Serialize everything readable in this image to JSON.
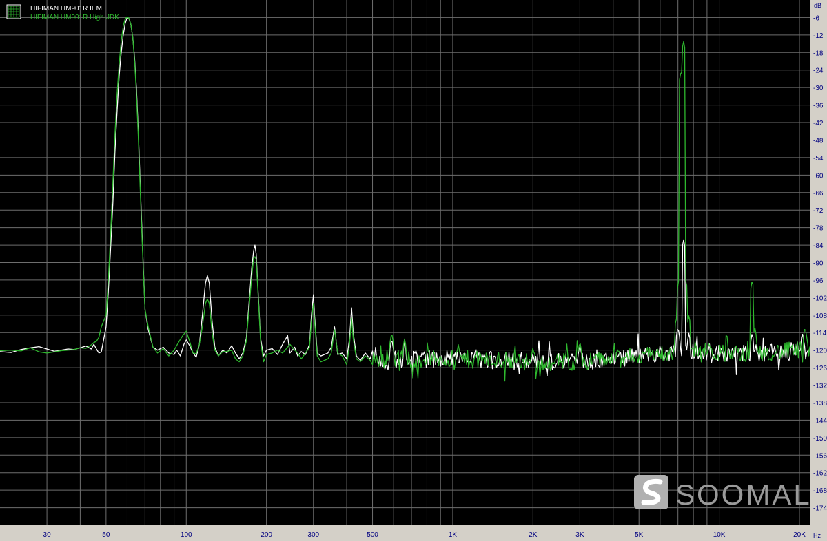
{
  "colors": {
    "background": "#000000",
    "grid": "#6e6e6e",
    "axis_panel": "#d4d0c8",
    "tick_label": "#000080",
    "series_white": "#ffffff",
    "series_green": "#2eb82e",
    "watermark": "#9a9a9a"
  },
  "legend": {
    "icon": "grid-icon",
    "entries": [
      {
        "label": "HIFIMAN HM901R IEM",
        "color": "#ffffff"
      },
      {
        "label": "HIFIMAN HM901R High-JDK",
        "color": "#2eb82e"
      }
    ]
  },
  "watermark": {
    "text": "SOOMAL",
    "icon": "soomal-logo-icon"
  },
  "chart_data": {
    "type": "line",
    "title": "",
    "xlabel": "",
    "ylabel": "",
    "x_unit": "Hz",
    "y_unit": "dB",
    "x_scale": "log",
    "xlim": [
      20,
      22000
    ],
    "ylim": [
      -180,
      0
    ],
    "grid": true,
    "legend_position": "top-left",
    "x_ticks": [
      {
        "value": 30,
        "label": "30"
      },
      {
        "value": 50,
        "label": "50"
      },
      {
        "value": 100,
        "label": "100"
      },
      {
        "value": 200,
        "label": "200"
      },
      {
        "value": 300,
        "label": "300"
      },
      {
        "value": 500,
        "label": "500"
      },
      {
        "value": 1000,
        "label": "1K"
      },
      {
        "value": 2000,
        "label": "2K"
      },
      {
        "value": 3000,
        "label": "3K"
      },
      {
        "value": 5000,
        "label": "5K"
      },
      {
        "value": 10000,
        "label": "10K"
      },
      {
        "value": 20000,
        "label": "20K"
      }
    ],
    "y_ticks": [
      -6,
      -12,
      -18,
      -24,
      -30,
      -36,
      -42,
      -48,
      -54,
      -60,
      -66,
      -72,
      -78,
      -84,
      -90,
      -96,
      -102,
      -108,
      -114,
      -120,
      -126,
      -132,
      -138,
      -144,
      -150,
      -156,
      -162,
      -168,
      -174
    ],
    "series": [
      {
        "name": "HIFIMAN HM901R IEM",
        "color": "#ffffff",
        "points": [
          [
            20,
            -120.5
          ],
          [
            22,
            -120.8
          ],
          [
            24,
            -119.8
          ],
          [
            26,
            -119.2
          ],
          [
            28,
            -118.8
          ],
          [
            30,
            -119.6
          ],
          [
            32,
            -120.4
          ],
          [
            34,
            -120.0
          ],
          [
            36,
            -119.6
          ],
          [
            38,
            -119.8
          ],
          [
            40,
            -119.2
          ],
          [
            42,
            -118.6
          ],
          [
            44,
            -119.6
          ],
          [
            45,
            -118.0
          ],
          [
            46,
            -119.6
          ],
          [
            47,
            -121.0
          ],
          [
            48,
            -120.6
          ],
          [
            50,
            -112.0
          ],
          [
            51,
            -100.0
          ],
          [
            52,
            -85.0
          ],
          [
            53,
            -70.0
          ],
          [
            54,
            -52.0
          ],
          [
            55,
            -38.0
          ],
          [
            56,
            -26.0
          ],
          [
            57,
            -18.0
          ],
          [
            58,
            -12.0
          ],
          [
            59,
            -8.0
          ],
          [
            60,
            -6.0
          ],
          [
            61,
            -6.5
          ],
          [
            62,
            -8.5
          ],
          [
            63,
            -13.0
          ],
          [
            64,
            -20.0
          ],
          [
            65,
            -30.0
          ],
          [
            66,
            -44.0
          ],
          [
            67,
            -60.0
          ],
          [
            68,
            -76.0
          ],
          [
            69,
            -92.0
          ],
          [
            70,
            -106.0
          ],
          [
            72,
            -113.0
          ],
          [
            75,
            -119.0
          ],
          [
            78,
            -120.0
          ],
          [
            82,
            -119.0
          ],
          [
            86,
            -121.0
          ],
          [
            90,
            -121.5
          ],
          [
            92,
            -120.0
          ],
          [
            95,
            -122.0
          ],
          [
            98,
            -118.0
          ],
          [
            100,
            -116.5
          ],
          [
            103,
            -118.5
          ],
          [
            106,
            -121.0
          ],
          [
            109,
            -122.4
          ],
          [
            112,
            -118.0
          ],
          [
            115,
            -108.0
          ],
          [
            118,
            -97.0
          ],
          [
            120,
            -94.5
          ],
          [
            122,
            -97.0
          ],
          [
            125,
            -110.0
          ],
          [
            128,
            -119.0
          ],
          [
            132,
            -122.0
          ],
          [
            137,
            -120.0
          ],
          [
            142,
            -121.0
          ],
          [
            148,
            -118.5
          ],
          [
            153,
            -121.0
          ],
          [
            158,
            -123.0
          ],
          [
            163,
            -121.0
          ],
          [
            168,
            -116.0
          ],
          [
            172,
            -104.0
          ],
          [
            176,
            -92.0
          ],
          [
            179,
            -86.0
          ],
          [
            181,
            -84.0
          ],
          [
            183,
            -87.0
          ],
          [
            186,
            -100.0
          ],
          [
            190,
            -116.0
          ],
          [
            195,
            -122.0
          ],
          [
            200,
            -120.0
          ],
          [
            210,
            -119.5
          ],
          [
            220,
            -121.5
          ],
          [
            230,
            -118.0
          ],
          [
            240,
            -115.0
          ],
          [
            245,
            -121.0
          ],
          [
            255,
            -119.0
          ],
          [
            262,
            -122.0
          ],
          [
            270,
            -120.5
          ],
          [
            280,
            -121.5
          ],
          [
            290,
            -118.0
          ],
          [
            295,
            -108.0
          ],
          [
            300,
            -101.0
          ],
          [
            303,
            -108.0
          ],
          [
            310,
            -121.0
          ],
          [
            320,
            -122.0
          ],
          [
            340,
            -121.0
          ],
          [
            350,
            -119.0
          ],
          [
            360,
            -112.0
          ],
          [
            370,
            -121.5
          ],
          [
            385,
            -121.0
          ],
          [
            400,
            -123.0
          ],
          [
            410,
            -116.0
          ],
          [
            417,
            -105.5
          ],
          [
            423,
            -114.0
          ],
          [
            435,
            -122.0
          ],
          [
            450,
            -123.5
          ],
          [
            470,
            -121.0
          ],
          [
            490,
            -123.0
          ]
        ]
      },
      {
        "name": "HIFIMAN HM901R High-JDK",
        "color": "#2eb82e",
        "points": [
          [
            20,
            -120.2
          ],
          [
            22,
            -120.0
          ],
          [
            24,
            -120.3
          ],
          [
            26,
            -119.2
          ],
          [
            28,
            -120.6
          ],
          [
            30,
            -121.0
          ],
          [
            32,
            -120.6
          ],
          [
            34,
            -120.2
          ],
          [
            36,
            -120.0
          ],
          [
            38,
            -119.8
          ],
          [
            40,
            -119.2
          ],
          [
            42,
            -119.4
          ],
          [
            44,
            -118.2
          ],
          [
            45,
            -117.4
          ],
          [
            46,
            -117.0
          ],
          [
            47,
            -115.6
          ],
          [
            48,
            -112.0
          ],
          [
            50,
            -108.0
          ],
          [
            51,
            -96.0
          ],
          [
            52,
            -80.0
          ],
          [
            53,
            -63.0
          ],
          [
            54,
            -46.0
          ],
          [
            55,
            -32.0
          ],
          [
            56,
            -22.0
          ],
          [
            57,
            -14.0
          ],
          [
            58,
            -9.0
          ],
          [
            59,
            -6.4
          ],
          [
            60,
            -5.8
          ],
          [
            61,
            -6.3
          ],
          [
            62,
            -8.5
          ],
          [
            63,
            -13.0
          ],
          [
            64,
            -21.0
          ],
          [
            65,
            -32.0
          ],
          [
            66,
            -46.0
          ],
          [
            67,
            -62.0
          ],
          [
            68,
            -78.0
          ],
          [
            69,
            -93.0
          ],
          [
            70,
            -106.0
          ],
          [
            72,
            -112.0
          ],
          [
            75,
            -119.0
          ],
          [
            78,
            -121.0
          ],
          [
            82,
            -119.5
          ],
          [
            86,
            -122.0
          ],
          [
            90,
            -120.0
          ],
          [
            94,
            -117.0
          ],
          [
            97,
            -115.0
          ],
          [
            100,
            -113.5
          ],
          [
            103,
            -117.0
          ],
          [
            106,
            -121.0
          ],
          [
            109,
            -121.2
          ],
          [
            112,
            -118.0
          ],
          [
            115,
            -112.0
          ],
          [
            118,
            -104.0
          ],
          [
            120,
            -102.5
          ],
          [
            122,
            -104.0
          ],
          [
            125,
            -114.0
          ],
          [
            128,
            -120.0
          ],
          [
            132,
            -122.0
          ],
          [
            137,
            -120.5
          ],
          [
            142,
            -120.5
          ],
          [
            148,
            -120.0
          ],
          [
            153,
            -123.0
          ],
          [
            158,
            -124.0
          ],
          [
            163,
            -122.0
          ],
          [
            168,
            -117.0
          ],
          [
            172,
            -106.0
          ],
          [
            176,
            -95.0
          ],
          [
            179,
            -88.5
          ],
          [
            181,
            -88.0
          ],
          [
            183,
            -89.0
          ],
          [
            186,
            -101.0
          ],
          [
            190,
            -117.0
          ],
          [
            195,
            -124.0
          ],
          [
            200,
            -121.5
          ],
          [
            210,
            -121.0
          ],
          [
            220,
            -120.0
          ],
          [
            230,
            -121.0
          ],
          [
            240,
            -119.0
          ],
          [
            245,
            -118.0
          ],
          [
            255,
            -120.0
          ],
          [
            262,
            -121.0
          ],
          [
            270,
            -123.0
          ],
          [
            280,
            -121.0
          ],
          [
            290,
            -119.0
          ],
          [
            295,
            -110.0
          ],
          [
            300,
            -104.0
          ],
          [
            303,
            -110.0
          ],
          [
            310,
            -122.0
          ],
          [
            320,
            -124.0
          ],
          [
            340,
            -123.0
          ],
          [
            350,
            -121.0
          ],
          [
            360,
            -113.0
          ],
          [
            370,
            -121.0
          ],
          [
            385,
            -122.0
          ],
          [
            400,
            -125.0
          ],
          [
            410,
            -118.0
          ],
          [
            417,
            -109.0
          ],
          [
            423,
            -116.0
          ],
          [
            435,
            -123.0
          ],
          [
            450,
            -124.0
          ],
          [
            470,
            -122.0
          ],
          [
            490,
            -123.5
          ]
        ]
      }
    ],
    "high_band": {
      "from_hz": 500,
      "to_hz": 22000,
      "noise_floor_db": [
        [
          500,
          -123.0
        ],
        [
          1000,
          -123.0
        ],
        [
          2000,
          -124.0
        ],
        [
          3000,
          -124.0
        ],
        [
          5000,
          -122.0
        ],
        [
          8000,
          -120.0
        ],
        [
          10000,
          -121.0
        ],
        [
          14000,
          -121.0
        ],
        [
          20000,
          -120.0
        ],
        [
          22000,
          -121.0
        ]
      ],
      "peaks": {
        "HIFIMAN HM901R IEM": [
          [
            590,
            -116.0
          ],
          [
            660,
            -117.0
          ],
          [
            2000,
            -121.0
          ],
          [
            3000,
            -118.0
          ],
          [
            7000,
            -112.0
          ],
          [
            7350,
            -82.0
          ],
          [
            7500,
            -118.0
          ],
          [
            7700,
            -114.0
          ],
          [
            13300,
            -114.0
          ],
          [
            20500,
            -114.0
          ]
        ],
        "HIFIMAN HM901R High-JDK": [
          [
            590,
            -114.0
          ],
          [
            660,
            -116.0
          ],
          [
            1050,
            -118.0
          ],
          [
            2000,
            -119.0
          ],
          [
            3000,
            -117.0
          ],
          [
            6900,
            -109.0
          ],
          [
            7050,
            -96.0
          ],
          [
            7200,
            -24.0
          ],
          [
            7350,
            -14.0
          ],
          [
            7500,
            -96.0
          ],
          [
            7700,
            -108.0
          ],
          [
            13300,
            -96.0
          ],
          [
            13600,
            -112.0
          ],
          [
            21000,
            -112.0
          ]
        ]
      }
    }
  }
}
